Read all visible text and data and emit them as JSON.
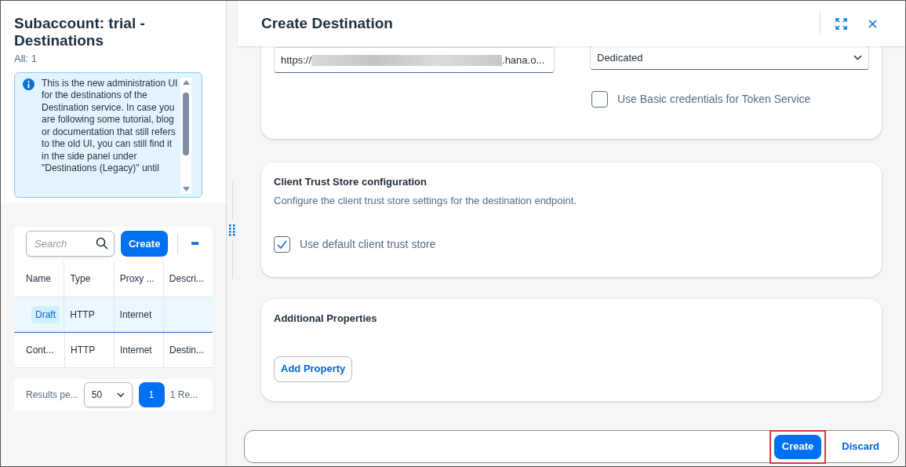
{
  "sidebar": {
    "title": "Subaccount: trial - Destinations",
    "count": "All: 1",
    "info_message": "This is the new administration UI for the destinations of the Destination service. In case you are following some tutorial, blog or documentation that still refers to the old UI, you can still find it in the side panel under \"Destinations (Legacy)\" until",
    "search": {
      "placeholder": "Search"
    },
    "create_button": "Create",
    "more_button": "•••",
    "table": {
      "columns": [
        "Name",
        "Type",
        "Proxy ...",
        "Descri..."
      ],
      "rows": [
        {
          "selected": true,
          "cells": [
            {
              "kind": "badge",
              "text": "Draft"
            },
            {
              "kind": "text",
              "text": "HTTP"
            },
            {
              "kind": "text",
              "text": "Internet"
            }
          ]
        },
        {
          "selected": false,
          "cells": [
            {
              "kind": "text",
              "text": "Cont..."
            },
            {
              "kind": "text",
              "text": "HTTP"
            },
            {
              "kind": "text",
              "text": "Internet"
            },
            {
              "kind": "text",
              "text": "Destin..."
            }
          ]
        }
      ]
    },
    "pagination": {
      "label": "Results pe...",
      "page_size": "50",
      "pages": [
        {
          "label": "1",
          "selected": true
        }
      ],
      "summary": "1 Re..."
    }
  },
  "dialog": {
    "title": "Create Destination",
    "url_field": {
      "prefix": "https://",
      "suffix": ".hana.o..."
    },
    "select": {
      "value": "Dedicated"
    },
    "token_checkbox": {
      "label": "Use Basic credentials for Token Service",
      "checked": false
    },
    "trust_store": {
      "title": "Client Trust Store configuration",
      "description": "Configure the client trust store settings for the destination endpoint.",
      "checkbox": {
        "label": "Use default client trust store",
        "checked": true
      }
    },
    "additional": {
      "title": "Additional Properties",
      "button": "Add Property"
    },
    "footer": [
      {
        "label": "Create",
        "kind": "primary",
        "highlighted": true
      },
      {
        "label": "Discard",
        "kind": "link",
        "highlighted": false
      }
    ]
  }
}
